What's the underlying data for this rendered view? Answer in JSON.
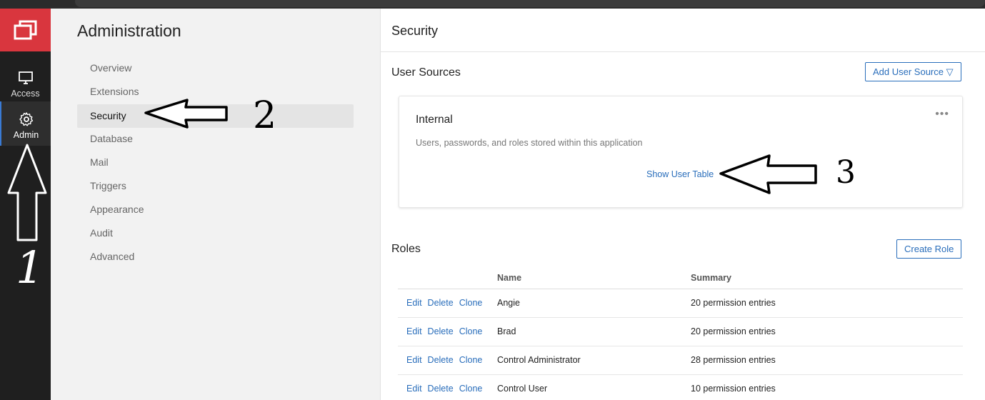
{
  "rail": {
    "items": [
      {
        "label": "Access",
        "icon": "monitor-icon"
      },
      {
        "label": "Admin",
        "icon": "gear-icon"
      }
    ],
    "logo_color": "#d9363e"
  },
  "admin_panel": {
    "title": "Administration",
    "nav": [
      "Overview",
      "Extensions",
      "Security",
      "Database",
      "Mail",
      "Triggers",
      "Appearance",
      "Audit",
      "Advanced"
    ],
    "active": "Security"
  },
  "main": {
    "header": "Security",
    "user_sources": {
      "title": "User Sources",
      "add_button": "Add User Source ▽",
      "card": {
        "title": "Internal",
        "description": "Users, passwords, and roles stored within this application",
        "link": "Show User Table",
        "more": "•••"
      }
    },
    "roles": {
      "title": "Roles",
      "create_button": "Create Role",
      "columns": [
        "",
        "Name",
        "Summary"
      ],
      "actions": [
        "Edit",
        "Delete",
        "Clone"
      ],
      "rows": [
        {
          "name": "Angie",
          "summary": "20 permission entries"
        },
        {
          "name": "Brad",
          "summary": "20 permission entries"
        },
        {
          "name": "Control Administrator",
          "summary": "28 permission entries"
        },
        {
          "name": "Control User",
          "summary": "10 permission entries"
        }
      ]
    }
  },
  "annotations": {
    "n1": "1",
    "n2": "2",
    "n3": "3"
  },
  "colors": {
    "accent": "#2a6ebb",
    "brand": "#d9363e"
  }
}
